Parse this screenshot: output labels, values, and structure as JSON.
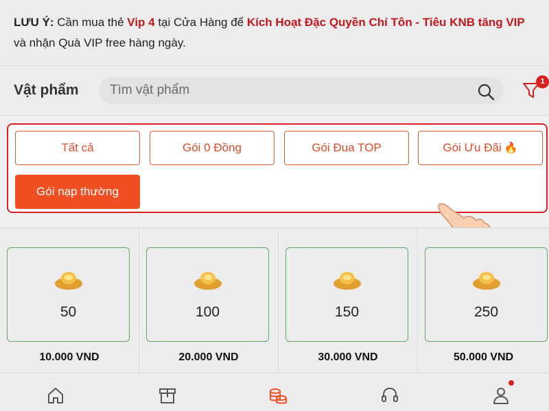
{
  "notice": {
    "prefix": "LƯU Ý:",
    "text1": " Cần mua thẻ ",
    "vip": "Vip 4",
    "text2": " tại Cửa Hàng để ",
    "privilege": "Kích Hoạt Đặc Quyền Chí Tôn - Tiêu KNB tăng VIP",
    "text3": " và nhận Quà VIP free hàng ngày."
  },
  "search": {
    "title": "Vật phẩm",
    "placeholder": "Tìm vật phẩm",
    "filter_badge": "1"
  },
  "tabs": [
    {
      "label": "Tất cả"
    },
    {
      "label": "Gói 0 Đồng"
    },
    {
      "label": "Gói Đua TOP"
    },
    {
      "label": "Gói Ưu Đãi",
      "icon": "fire-icon"
    },
    {
      "label": "Gói nạp thường",
      "active": true
    }
  ],
  "products": [
    {
      "amount": "50",
      "price": "10.000 VND",
      "icon": "gold-ingot-icon"
    },
    {
      "amount": "100",
      "price": "20.000 VND",
      "icon": "gold-ingot-icon"
    },
    {
      "amount": "150",
      "price": "30.000 VND",
      "icon": "gold-ingot-icon"
    },
    {
      "amount": "250",
      "price": "50.000 VND",
      "icon": "gold-ingot-icon"
    }
  ],
  "bottom_nav": [
    {
      "icon": "home-icon"
    },
    {
      "icon": "store-icon"
    },
    {
      "icon": "coins-icon",
      "active": true
    },
    {
      "icon": "headset-icon"
    },
    {
      "icon": "user-icon",
      "has_dot": true
    }
  ],
  "colors": {
    "accent": "#f04e23",
    "highlight_border": "#d8201f",
    "notice_red": "#c0181e",
    "card_border": "#5fa864"
  }
}
